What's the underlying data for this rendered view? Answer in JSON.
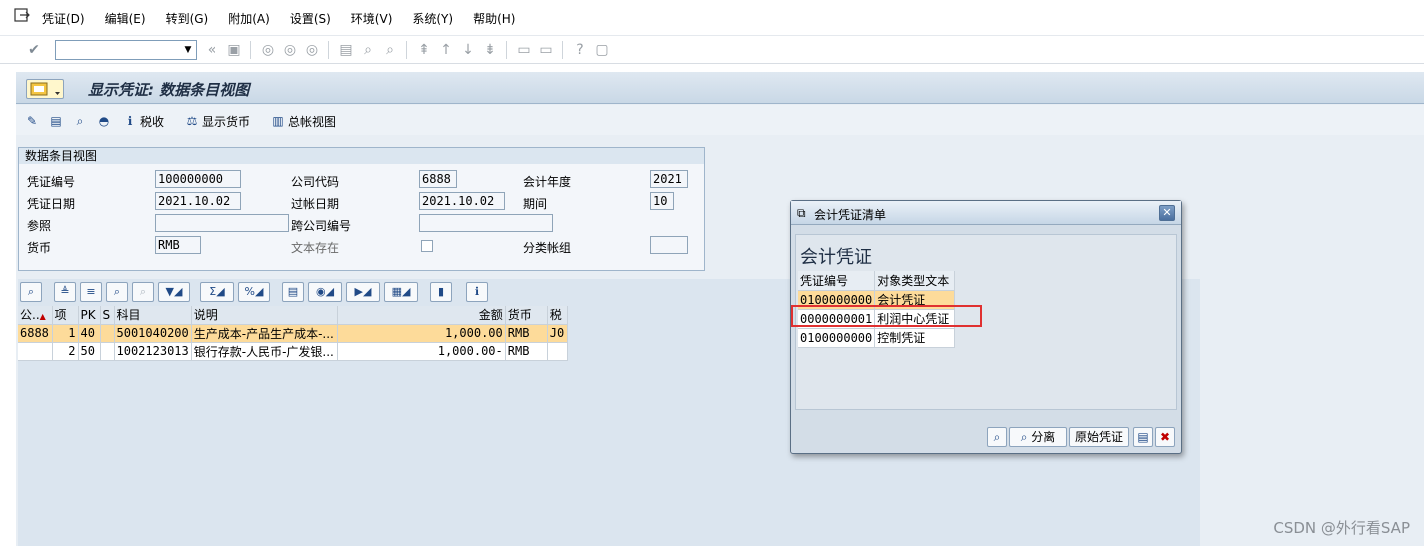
{
  "menu": [
    "凭证(D)",
    "编辑(E)",
    "转到(G)",
    "附加(A)",
    "设置(S)",
    "环境(V)",
    "系统(Y)",
    "帮助(H)"
  ],
  "page_title": "显示凭证: 数据条目视图",
  "app_toolbar": {
    "tax_label": "税收",
    "show_currency_label": "显示货币",
    "gl_view_label": "总帐视图"
  },
  "group": {
    "title": "数据条目视图",
    "fields": {
      "doc_no_label": "凭证编号",
      "doc_no": "100000000",
      "company_label": "公司代码",
      "company": "6888",
      "fiscal_year_label": "会计年度",
      "fiscal_year": "2021",
      "doc_date_label": "凭证日期",
      "doc_date": "2021.10.02",
      "posting_date_label": "过帐日期",
      "posting_date": "2021.10.02",
      "period_label": "期间",
      "period": "10",
      "reference_label": "参照",
      "reference": "",
      "cross_company_label": "跨公司编号",
      "cross_company": "",
      "currency_label": "货币",
      "currency": "RMB",
      "text_exists_label": "文本存在",
      "ledger_group_label": "分类帐组",
      "ledger_group": ""
    }
  },
  "grid": {
    "headers": [
      "公..",
      "项",
      "PK",
      "S",
      "科目",
      "说明",
      "金额",
      "货币",
      "税"
    ],
    "rows": [
      [
        "6888",
        "1",
        "40",
        "",
        "5001040200",
        "生产成本-产品生产成本-...",
        "1,000.00",
        "RMB",
        "J0"
      ],
      [
        "",
        "2",
        "50",
        "",
        "1002123013",
        "银行存款-人民币-广发银...",
        "1,000.00-",
        "RMB",
        ""
      ]
    ]
  },
  "dialog": {
    "title": "会计凭证清单",
    "heading": "会计凭证",
    "col_doc": "凭证编号",
    "col_type": "对象类型文本",
    "rows": [
      [
        "0100000000",
        "会计凭证"
      ],
      [
        "0000000001",
        "利润中心凭证"
      ],
      [
        "0100000000",
        "控制凭证"
      ]
    ],
    "btn_split": "分离",
    "btn_original": "原始凭证"
  },
  "watermark": "CSDN @外行看SAP"
}
